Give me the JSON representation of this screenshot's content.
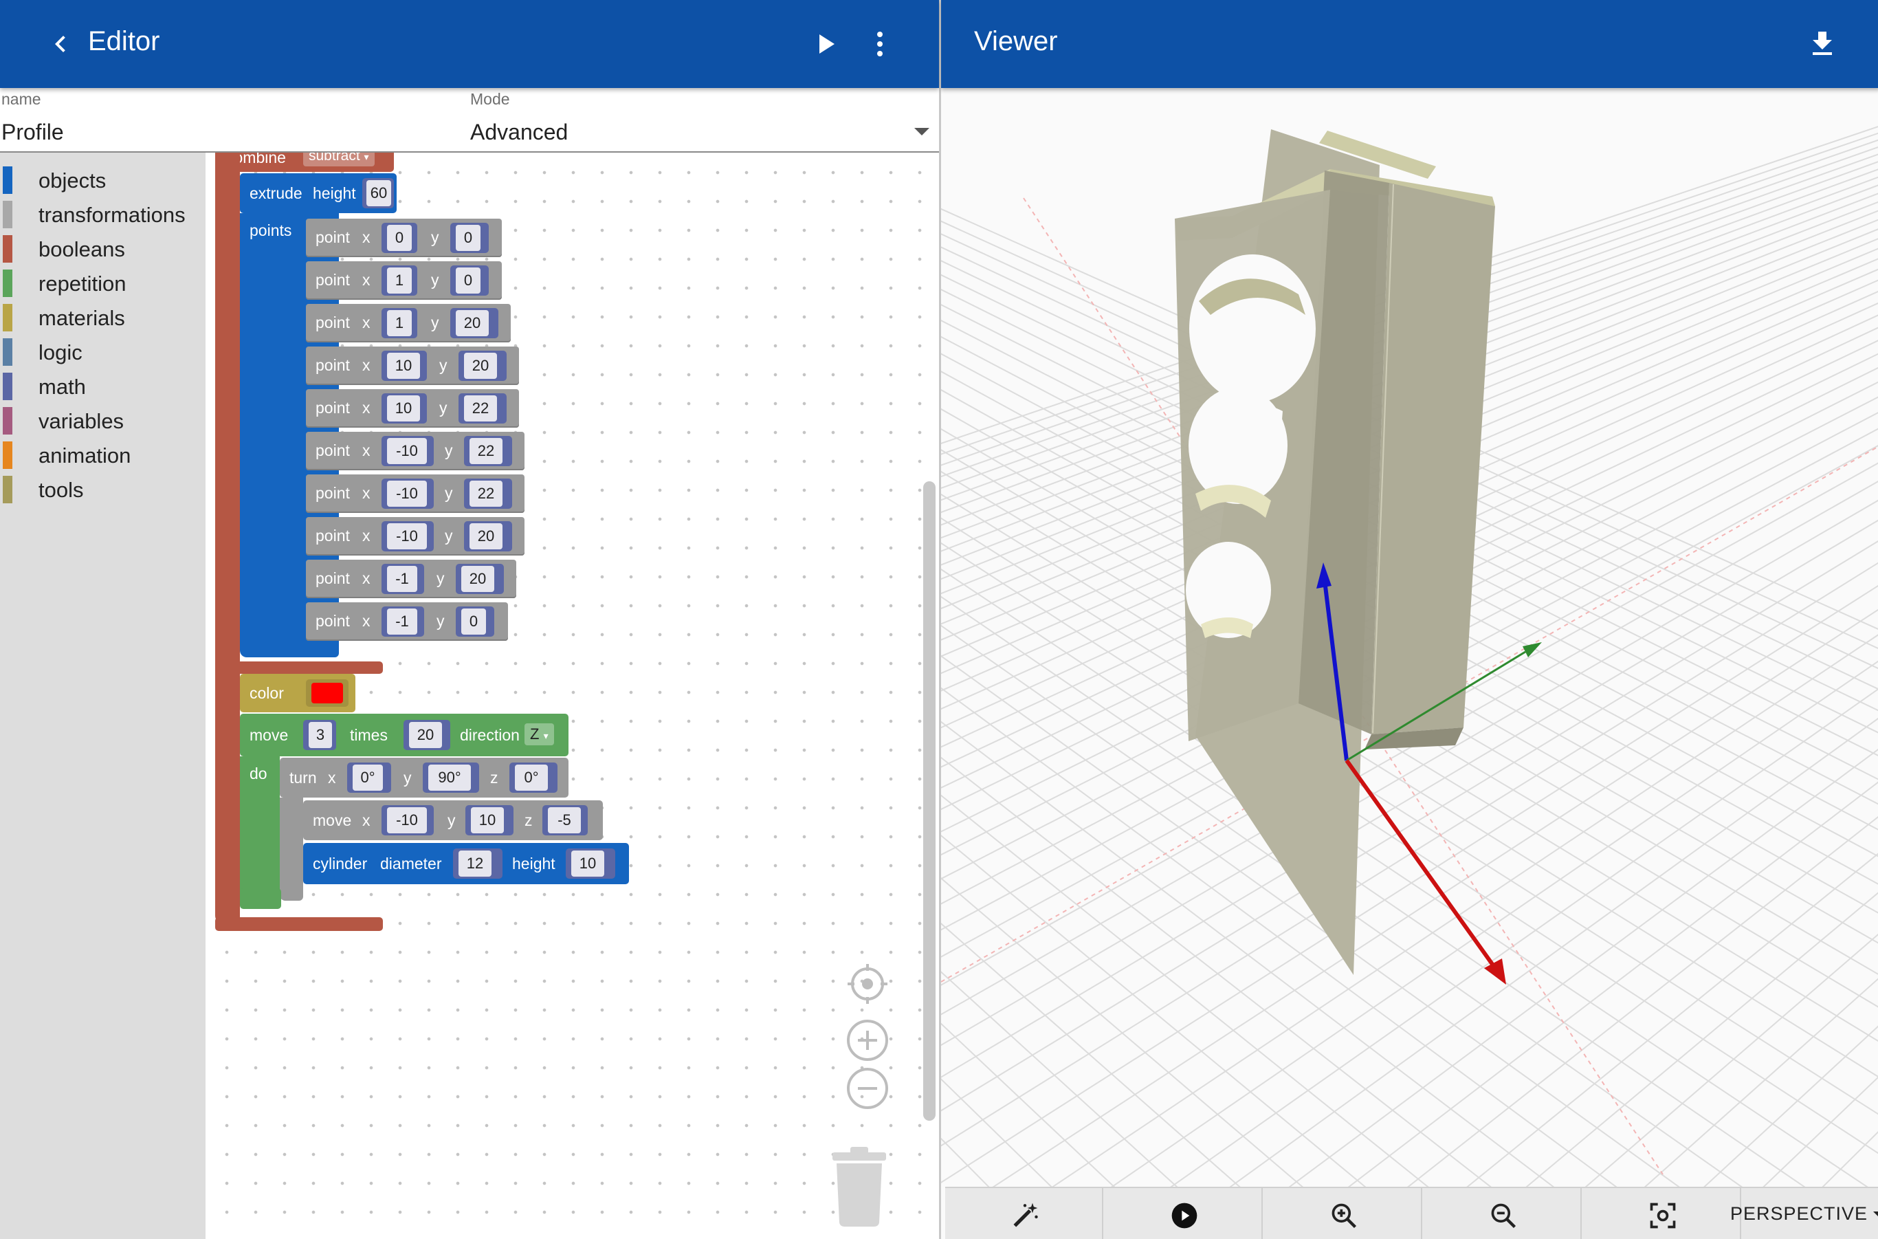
{
  "editor": {
    "title": "Editor",
    "name_label": "name",
    "name_value": "Profile",
    "mode_label": "Mode",
    "mode_value": "Advanced"
  },
  "toolbox": {
    "categories": [
      {
        "label": "objects",
        "color": "#1565c0"
      },
      {
        "label": "transformations",
        "color": "#a8a8a8"
      },
      {
        "label": "booleans",
        "color": "#b55744"
      },
      {
        "label": "repetition",
        "color": "#5ba55b"
      },
      {
        "label": "materials",
        "color": "#b9a547"
      },
      {
        "label": "logic",
        "color": "#5b80a5"
      },
      {
        "label": "math",
        "color": "#5b67a5"
      },
      {
        "label": "variables",
        "color": "#a55b80"
      },
      {
        "label": "animation",
        "color": "#e6861f"
      },
      {
        "label": "tools",
        "color": "#a59b5b"
      }
    ]
  },
  "blocks": {
    "combine": {
      "label": "combine",
      "op": "subtract"
    },
    "extrude": {
      "label": "extrude",
      "height_label": "height",
      "height": "60",
      "points_label": "points"
    },
    "point_label": "point",
    "x_label": "x",
    "y_label": "y",
    "z_label": "z",
    "points": [
      {
        "x": "0",
        "y": "0"
      },
      {
        "x": "1",
        "y": "0"
      },
      {
        "x": "1",
        "y": "20"
      },
      {
        "x": "10",
        "y": "20"
      },
      {
        "x": "10",
        "y": "22"
      },
      {
        "x": "-10",
        "y": "22"
      },
      {
        "x": "-10",
        "y": "22"
      },
      {
        "x": "-10",
        "y": "20"
      },
      {
        "x": "-1",
        "y": "20"
      },
      {
        "x": "-1",
        "y": "0"
      }
    ],
    "color": {
      "label": "color",
      "value": "#ff0000"
    },
    "repeat_move": {
      "label": "move",
      "count": "3",
      "times_label": "times",
      "step": "20",
      "direction_label": "direction",
      "direction": "Z",
      "do_label": "do"
    },
    "turn": {
      "label": "turn",
      "x": "0°",
      "y": "90°",
      "z": "0°"
    },
    "move": {
      "label": "move",
      "x": "-10",
      "y": "10",
      "z": "-5"
    },
    "cylinder": {
      "label": "cylinder",
      "diameter_label": "diameter",
      "diameter": "12",
      "height_label": "height",
      "height": "10"
    }
  },
  "viewer": {
    "title": "Viewer",
    "projection": "PERSPECTIVE"
  },
  "icons": [
    "back-arrow-icon",
    "play-icon",
    "more-vert-icon",
    "download-icon",
    "recenter-icon",
    "zoom-in-icon",
    "zoom-out-icon",
    "trash-icon",
    "magic-wand-icon",
    "play-circle-icon",
    "zoom-in-icon",
    "zoom-out-icon",
    "screenshot-icon"
  ]
}
